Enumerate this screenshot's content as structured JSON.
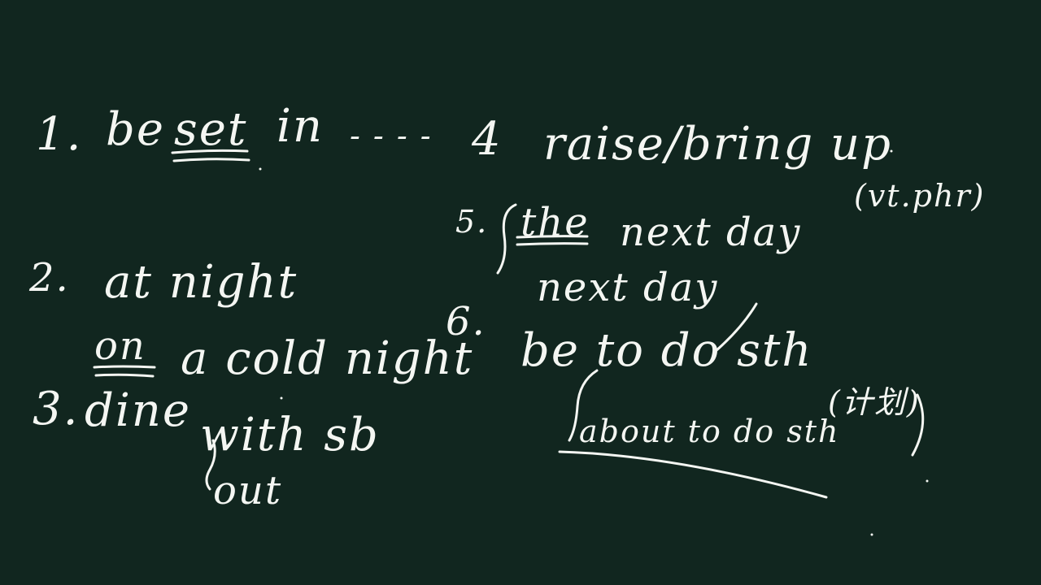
{
  "board": {
    "background": "#11261f",
    "ink_color": "#f4f6f2",
    "items": {
      "n1": "1.",
      "n1_be": "be",
      "n1_set": "set",
      "n1_in": "in",
      "n1_dots": "- - - -",
      "n2": "2.",
      "n2_line1": "at night",
      "n2_on": "on",
      "n2_line2": "a cold night",
      "n3": "3.",
      "n3_dine": "dine",
      "n3_with": "with sb",
      "n3_out": "out",
      "n4": "4",
      "n4_text": "raise/bring up",
      "n4_note": "(vt.phr)",
      "n5": "5.",
      "n5_the": "the",
      "n5_line1": "next day",
      "n5_line2": "next day",
      "n6": "6.",
      "n6_line1": "be to do sth",
      "n6_mark": "(计划)",
      "n6_line2": "about to do sth"
    }
  }
}
